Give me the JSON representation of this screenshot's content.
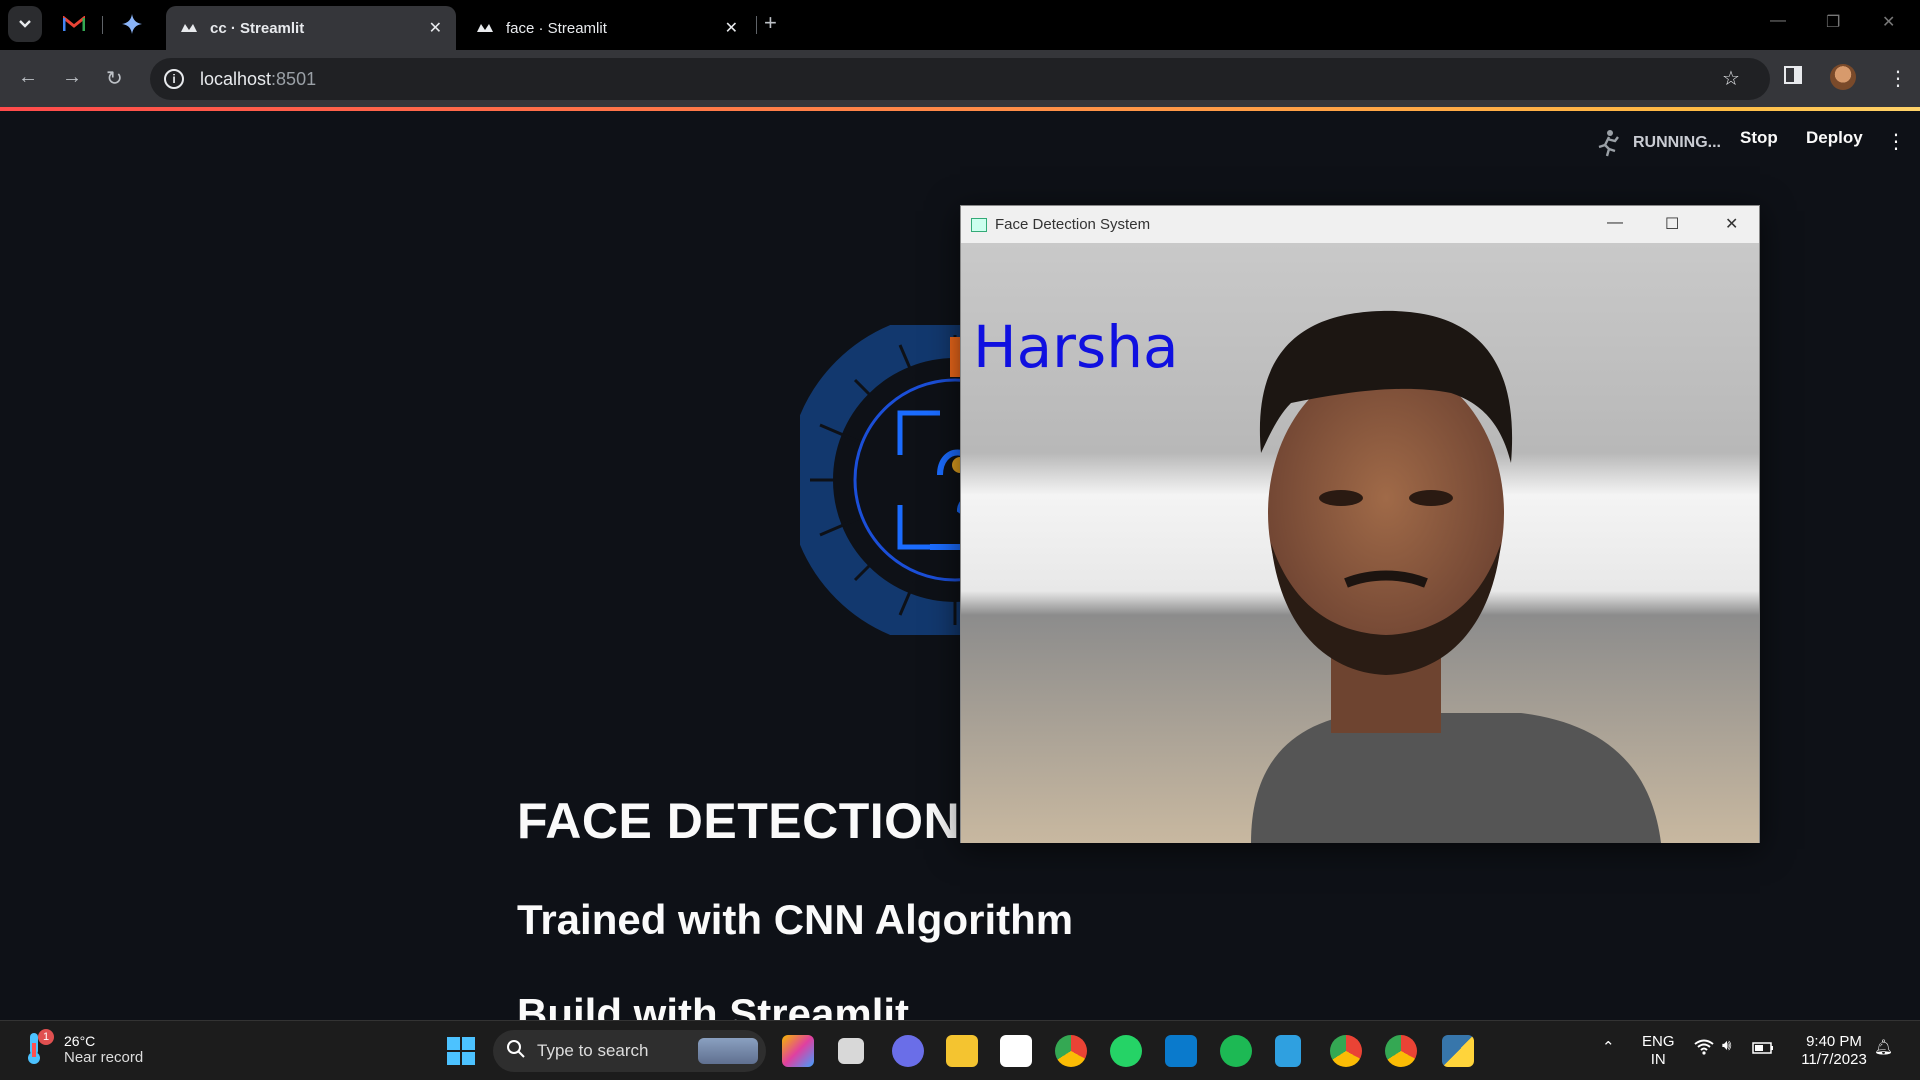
{
  "browser": {
    "tabs": [
      {
        "title": "cc · Streamlit",
        "active": true
      },
      {
        "title": "face · Streamlit",
        "active": false
      }
    ],
    "url_host": "localhost",
    "url_port": ":8501",
    "icons": [
      "tab-list-icon",
      "gmail-icon",
      "gemini-icon",
      "streamlit-icon",
      "close-icon",
      "new-tab-icon",
      "back-icon",
      "forward-icon",
      "reload-icon",
      "info-icon",
      "star-icon",
      "side-panel-icon",
      "profile-avatar",
      "menu-icon"
    ]
  },
  "streamlit": {
    "status": "RUNNING...",
    "stop_label": "Stop",
    "deploy_label": "Deploy",
    "heading": "FACE DETECTION",
    "subheading": "Trained with CNN Algorithm",
    "subheading2": "Build with Streamlit"
  },
  "cv_window": {
    "title": "Face Detection System",
    "detected_name": "Harsha"
  },
  "taskbar": {
    "weather_badge": "1",
    "temperature": "26°C",
    "weather_text": "Near record",
    "search_placeholder": "Type to search",
    "lang_top": "ENG",
    "lang_bottom": "IN",
    "time": "9:40 PM",
    "date": "11/7/2023",
    "apps": [
      "copilot-icon",
      "task-view-icon",
      "teams-icon",
      "file-explorer-icon",
      "store-icon",
      "chrome-icon",
      "whatsapp-icon",
      "vscode-icon",
      "spotify-icon",
      "notepad-icon",
      "chrome-profile-icon",
      "chrome-profile2-icon",
      "python-icon"
    ],
    "colors": {
      "accent": "#4cc2ff"
    }
  },
  "colors": {
    "app_bg": "#0e1117",
    "loading_bar_start": "#ff4b4b",
    "loading_bar_end": "#ffd36a",
    "label_blue": "#1010e0"
  }
}
